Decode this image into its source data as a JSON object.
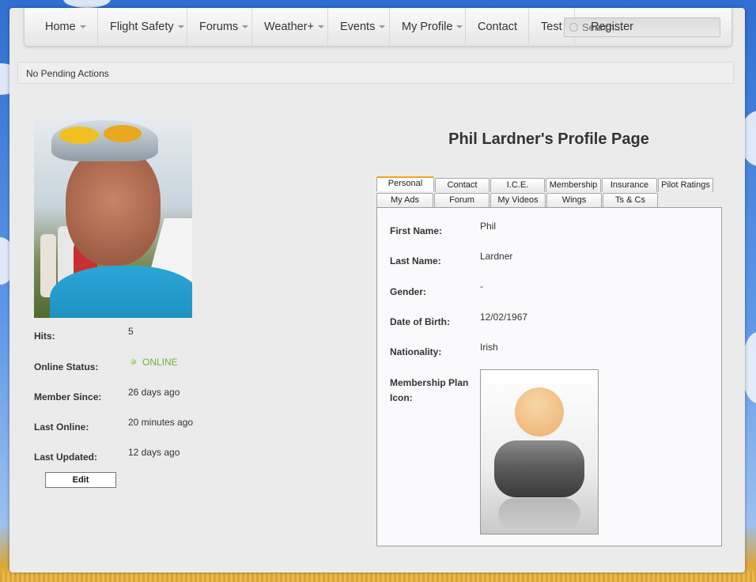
{
  "nav": {
    "items": [
      {
        "label": "Home",
        "dropdown": true
      },
      {
        "label": "Flight Safety",
        "dropdown": true
      },
      {
        "label": "Forums",
        "dropdown": true
      },
      {
        "label": "Weather+",
        "dropdown": true
      },
      {
        "label": "Events",
        "dropdown": true
      },
      {
        "label": "My Profile",
        "dropdown": true
      },
      {
        "label": "Contact",
        "dropdown": false
      },
      {
        "label": "Test",
        "dropdown": false
      }
    ],
    "register_label": "Register",
    "search_placeholder": "Search..."
  },
  "status_bar": {
    "text": "No Pending Actions"
  },
  "profile": {
    "title": "Phil Lardner's Profile Page",
    "stats": {
      "hits_label": "Hits:",
      "hits_value": "5",
      "online_label": "Online Status:",
      "online_value": "ONLINE",
      "member_since_label": "Member Since:",
      "member_since_value": "26 days ago",
      "last_online_label": "Last Online:",
      "last_online_value": "20 minutes ago",
      "last_updated_label": "Last Updated:",
      "last_updated_value": "12 days ago"
    },
    "edit_label": "Edit"
  },
  "tabs": {
    "row1": [
      "Personal",
      "Contact",
      "I.C.E.",
      "Membership",
      "Insurance",
      "Pilot Ratings"
    ],
    "row2": [
      "My Ads",
      "Forum",
      "My Videos",
      "Wings",
      "Ts & Cs"
    ],
    "active": "Personal"
  },
  "personal": {
    "first_name_label": "First Name:",
    "first_name": "Phil",
    "last_name_label": "Last Name:",
    "last_name": "Lardner",
    "gender_label": "Gender:",
    "gender": "-",
    "dob_label": "Date of Birth:",
    "dob": "12/02/1967",
    "nationality_label": "Nationality:",
    "nationality": "Irish",
    "membership_icon_label": "Membership Plan Icon:"
  },
  "colors": {
    "accent_tab": "#f0a524",
    "online": "#6cb33b"
  }
}
